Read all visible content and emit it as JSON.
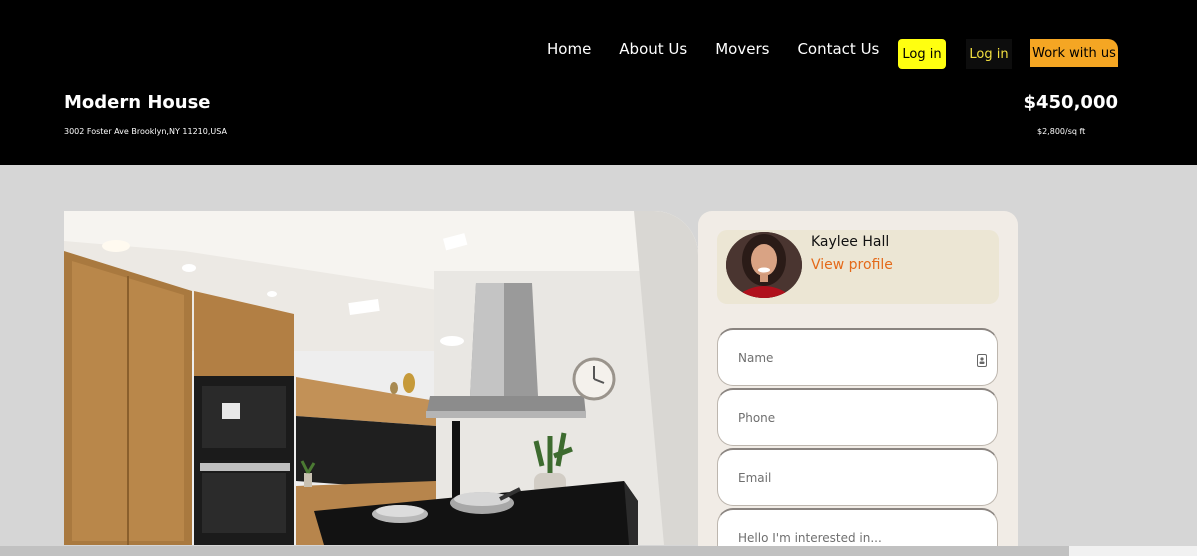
{
  "nav": {
    "links": [
      "Home",
      "About Us",
      "Movers",
      "Contact Us"
    ],
    "login_primary": "Log in",
    "login_secondary": "Log in",
    "work_with_us": "Work with us"
  },
  "property": {
    "title": "Modern House",
    "address": "3002 Foster Ave Brooklyn,NY 11210,USA",
    "price": "$450,000",
    "price_per_sqft": "$2,800/sq ft"
  },
  "agent": {
    "name": "Kaylee Hall",
    "profile_link": "View profile"
  },
  "form": {
    "name_placeholder": "Name",
    "phone_placeholder": "Phone",
    "email_placeholder": "Email",
    "message_placeholder": "Hello I'm interested in..."
  },
  "colors": {
    "header_bg": "#000000",
    "page_bg": "#d6d6d6",
    "login_yellow": "#ffff10",
    "accent_orange": "#f5a623",
    "link_orange": "#e46a1a",
    "card_bg": "#f1ece6"
  },
  "icons": [
    "contact-card-icon"
  ]
}
